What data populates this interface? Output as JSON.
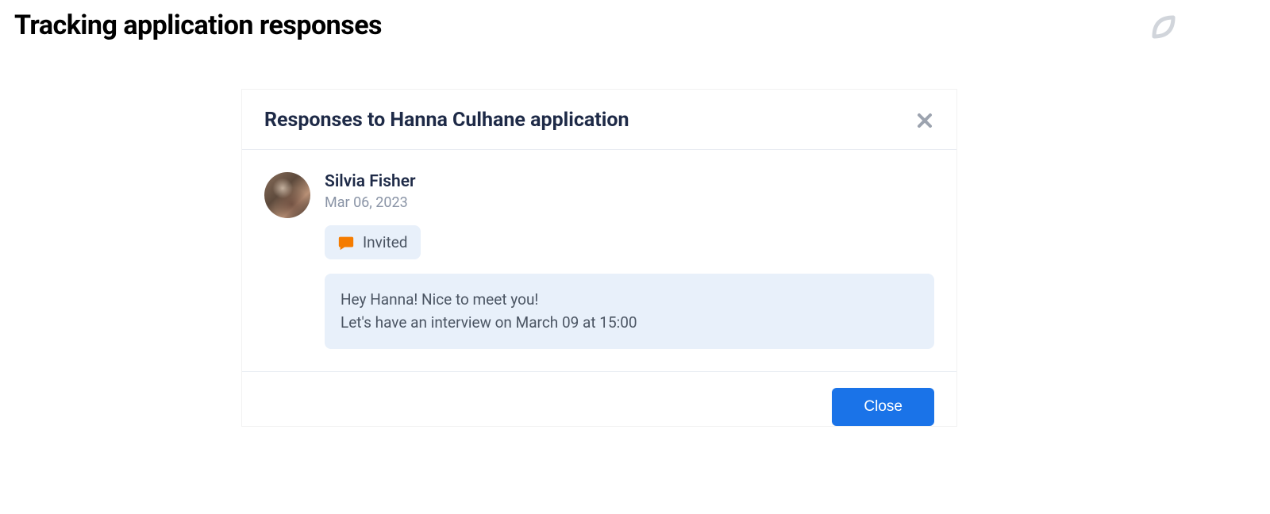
{
  "page": {
    "title": "Tracking application responses"
  },
  "modal": {
    "title": "Responses to Hanna Culhane application",
    "close_button_label": "Close"
  },
  "response": {
    "author_name": "Silvia Fisher",
    "date": "Mar 06, 2023",
    "status_label": "Invited",
    "message": "Hey Hanna! Nice to meet you!\nLet's have an interview on March 09 at 15:00"
  },
  "icons": {
    "chat": "chat-icon",
    "close": "close-icon",
    "logo": "leaf-logo-icon"
  },
  "colors": {
    "accent": "#1a73e8",
    "status_icon": "#f57c00",
    "badge_bg": "#e8f0fa"
  }
}
